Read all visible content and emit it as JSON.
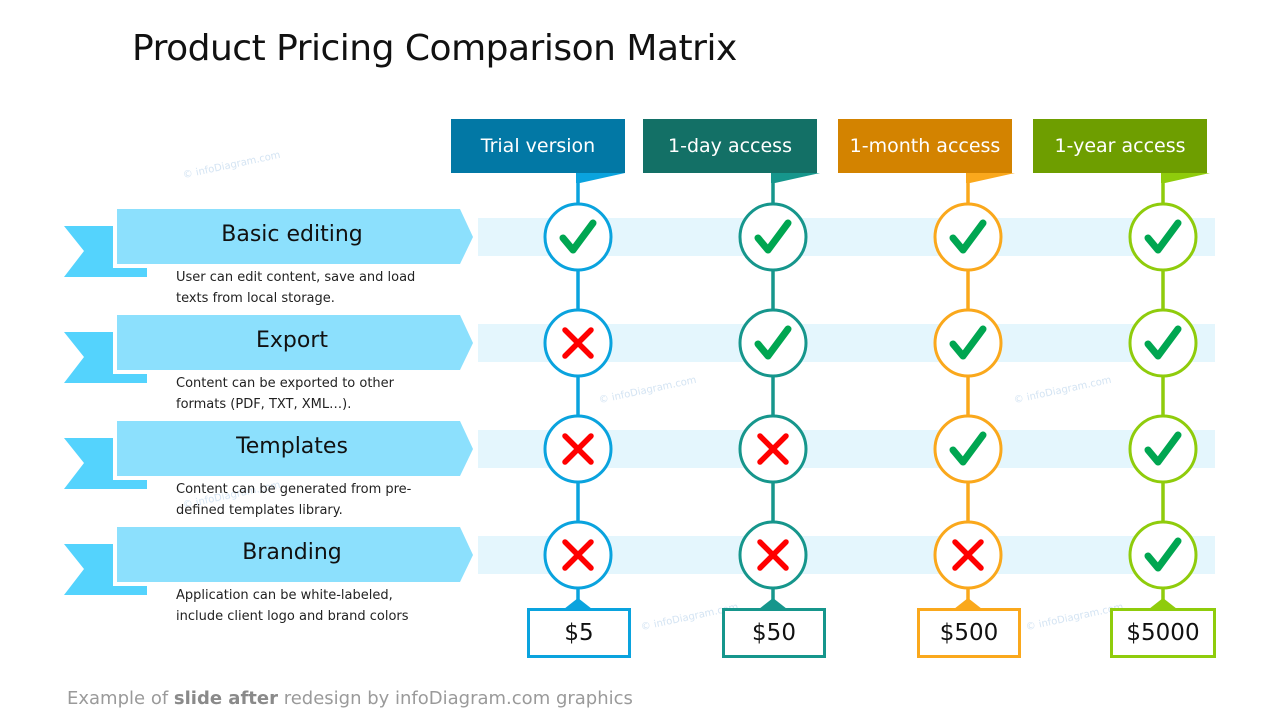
{
  "title": "Product Pricing Comparison Matrix",
  "plans": [
    {
      "name": "Trial version",
      "price": "$5",
      "header_color": "#0278a5",
      "line_color": "#0aa3de"
    },
    {
      "name": "1-day access",
      "price": "$50",
      "header_color": "#137066",
      "line_color": "#16968c"
    },
    {
      "name": "1-month access",
      "price": "$500",
      "header_color": "#d38300",
      "line_color": "#faa81c"
    },
    {
      "name": "1-year access",
      "price": "$5000",
      "header_color": "#6e9e00",
      "line_color": "#8fcc0c"
    }
  ],
  "features": [
    {
      "name": "Basic editing",
      "description_lines": [
        "User can edit content, save and load",
        "texts from local storage."
      ],
      "availability": [
        true,
        true,
        true,
        true
      ]
    },
    {
      "name": "Export",
      "description_lines": [
        "Content can be exported to other",
        "formats (PDF, TXT, XML…)."
      ],
      "availability": [
        false,
        true,
        true,
        true
      ]
    },
    {
      "name": "Templates",
      "description_lines": [
        "Content can be generated from pre-",
        "defined templates library."
      ],
      "availability": [
        false,
        false,
        true,
        true
      ]
    },
    {
      "name": "Branding",
      "description_lines": [
        "Application can be white-labeled,",
        "include client logo and brand colors"
      ],
      "availability": [
        false,
        false,
        false,
        true
      ]
    }
  ],
  "icons": {
    "available": "check-icon",
    "unavailable": "cross-icon"
  },
  "colors": {
    "check": "#00a651",
    "cross": "#ff0000",
    "banner": "#8ce0fd",
    "notch": "#54d3fd",
    "band": "#e4f6fd"
  },
  "watermark": "© infoDiagram.com",
  "footer": {
    "prefix": "Example of ",
    "bold": "slide after",
    "suffix": " redesign by infoDiagram.com graphics"
  }
}
